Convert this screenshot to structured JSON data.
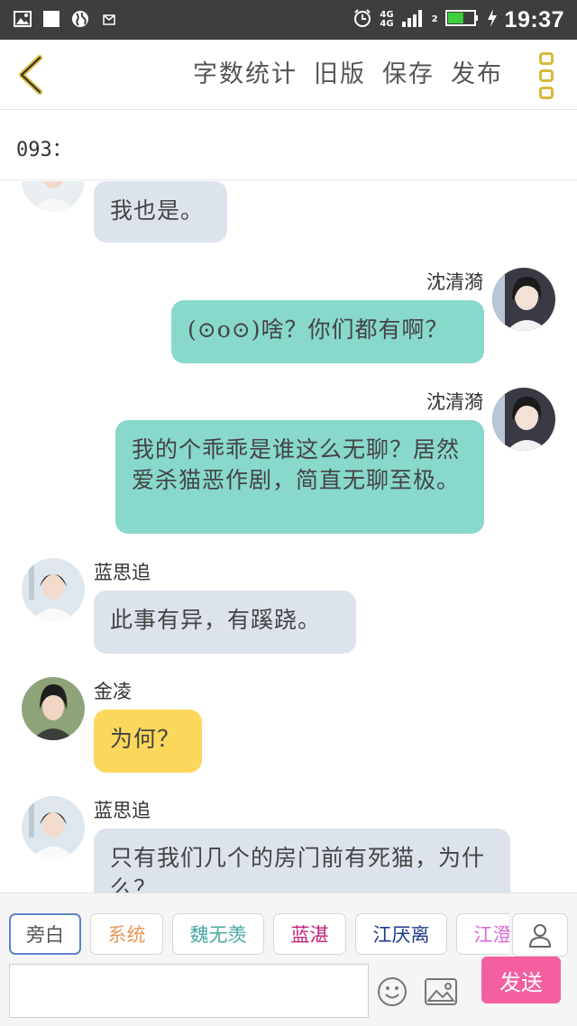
{
  "status_bar": {
    "network": "4G",
    "network2": "4G",
    "signal_sub": "2",
    "time": "19:37",
    "battery_level": 0.6
  },
  "header": {
    "actions": [
      "字数统计",
      "旧版",
      "保存",
      "发布"
    ]
  },
  "chapter_title": "093：",
  "messages": [
    {
      "name": "",
      "text": "我也是。",
      "side": "left",
      "style": "grey"
    },
    {
      "name": "沈清漪",
      "text": "(⊙o⊙)啥？你们都有啊？",
      "side": "right",
      "style": "teal"
    },
    {
      "name": "沈清漪",
      "text": "我的个乖乖是谁这么无聊？居然爱杀猫恶作剧，简直无聊至极。",
      "side": "right",
      "style": "teal"
    },
    {
      "name": "蓝思追",
      "text": "此事有异，有蹊跷。",
      "side": "left",
      "style": "grey"
    },
    {
      "name": "金凌",
      "text": "为何？",
      "side": "left",
      "style": "yellow"
    },
    {
      "name": "蓝思追",
      "text": "只有我们几个的房门前有死猫，为什么？",
      "side": "left",
      "style": "grey"
    }
  ],
  "roles": [
    {
      "label": "旁白",
      "color": "#555555"
    },
    {
      "label": "系统",
      "color": "#e8965a"
    },
    {
      "label": "魏无羡",
      "color": "#4aa8a0"
    },
    {
      "label": "蓝湛",
      "color": "#c2207a"
    },
    {
      "label": "江厌离",
      "color": "#1d3a8a"
    },
    {
      "label": "江澄",
      "color": "#d86cd8"
    }
  ],
  "input": {
    "placeholder": ""
  },
  "send_label": "发送",
  "icons": {
    "back": "back-chevron-icon",
    "menu": "menu-dots-icon",
    "contact": "person-icon",
    "emoji": "smiley-icon",
    "image": "image-icon"
  },
  "colors": {
    "accent_yellow": "#d9b83a",
    "send_pink": "#f45fa0",
    "bubble_grey": "#dde3ec",
    "bubble_teal": "#88d8cc",
    "bubble_yellow": "#fbd75b"
  }
}
